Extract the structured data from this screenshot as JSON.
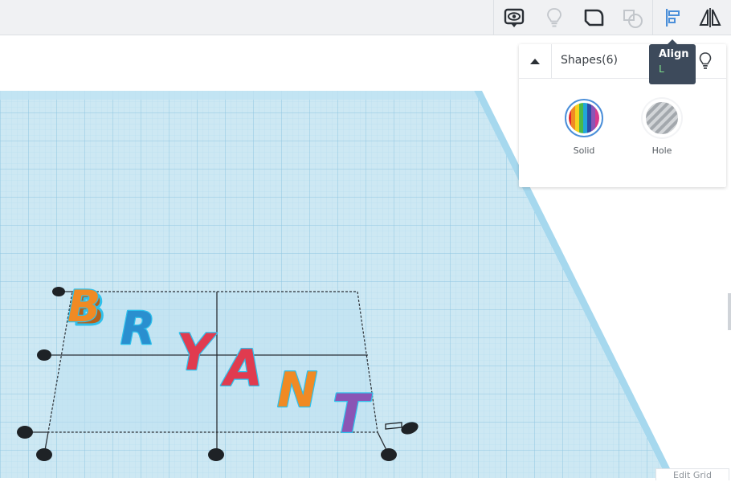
{
  "toolbar": {
    "buttons": [
      {
        "name": "show-all-icon"
      },
      {
        "name": "light-bulb-icon"
      },
      {
        "name": "group-shape-icon"
      },
      {
        "name": "ungroup-icon"
      },
      {
        "name": "align-icon"
      },
      {
        "name": "mirror-icon"
      }
    ]
  },
  "tooltip": {
    "title": "Align",
    "shortcut": "L"
  },
  "shapes_panel": {
    "title": "Shapes(6)",
    "solid_label": "Solid",
    "hole_label": "Hole"
  },
  "workplane": {
    "letters": [
      "B",
      "R",
      "Y",
      "A",
      "N",
      "T"
    ],
    "letter_colors": [
      "#f08a24",
      "#2a8fcf",
      "#e03b4f",
      "#e03b4f",
      "#f08a24",
      "#8a55b5"
    ]
  },
  "edit_grid_label": "Edit Grid",
  "colors": {
    "grid_fill": "#cde8f3",
    "grid_line": "#9fd0e6",
    "grid_edge": "#a6d8ee",
    "tooltip_bg": "#3d4a5b",
    "tooltip_key": "#7ee08a"
  }
}
